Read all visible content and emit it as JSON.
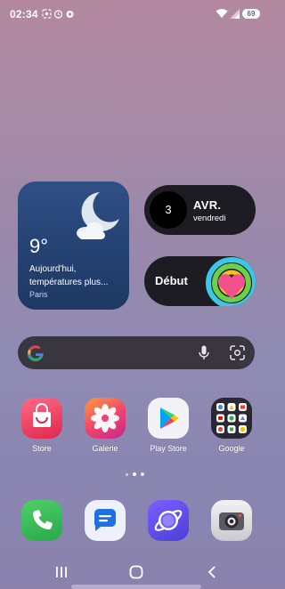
{
  "status_bar": {
    "time": "02:34",
    "battery": "69"
  },
  "weather": {
    "temperature": "9°",
    "description": "Aujourd'hui, températures plus...",
    "city": "Paris"
  },
  "date_widget": {
    "day": "3",
    "month": "AVR.",
    "weekday": "vendredi"
  },
  "debut_widget": {
    "label": "Début"
  },
  "apps": [
    {
      "label": "Store",
      "icon": "store-icon"
    },
    {
      "label": "Galerie",
      "icon": "gallery-icon"
    },
    {
      "label": "Play Store",
      "icon": "play-store-icon"
    },
    {
      "label": "Google",
      "icon": "google-folder-icon"
    }
  ],
  "dock": [
    {
      "icon": "phone-icon"
    },
    {
      "icon": "messages-icon"
    },
    {
      "icon": "internet-icon"
    },
    {
      "icon": "camera-icon"
    }
  ],
  "colors": {
    "widget_dark": "#1d1c22",
    "weather_blue": "#2a4a80",
    "search_bar": "#39363f"
  }
}
